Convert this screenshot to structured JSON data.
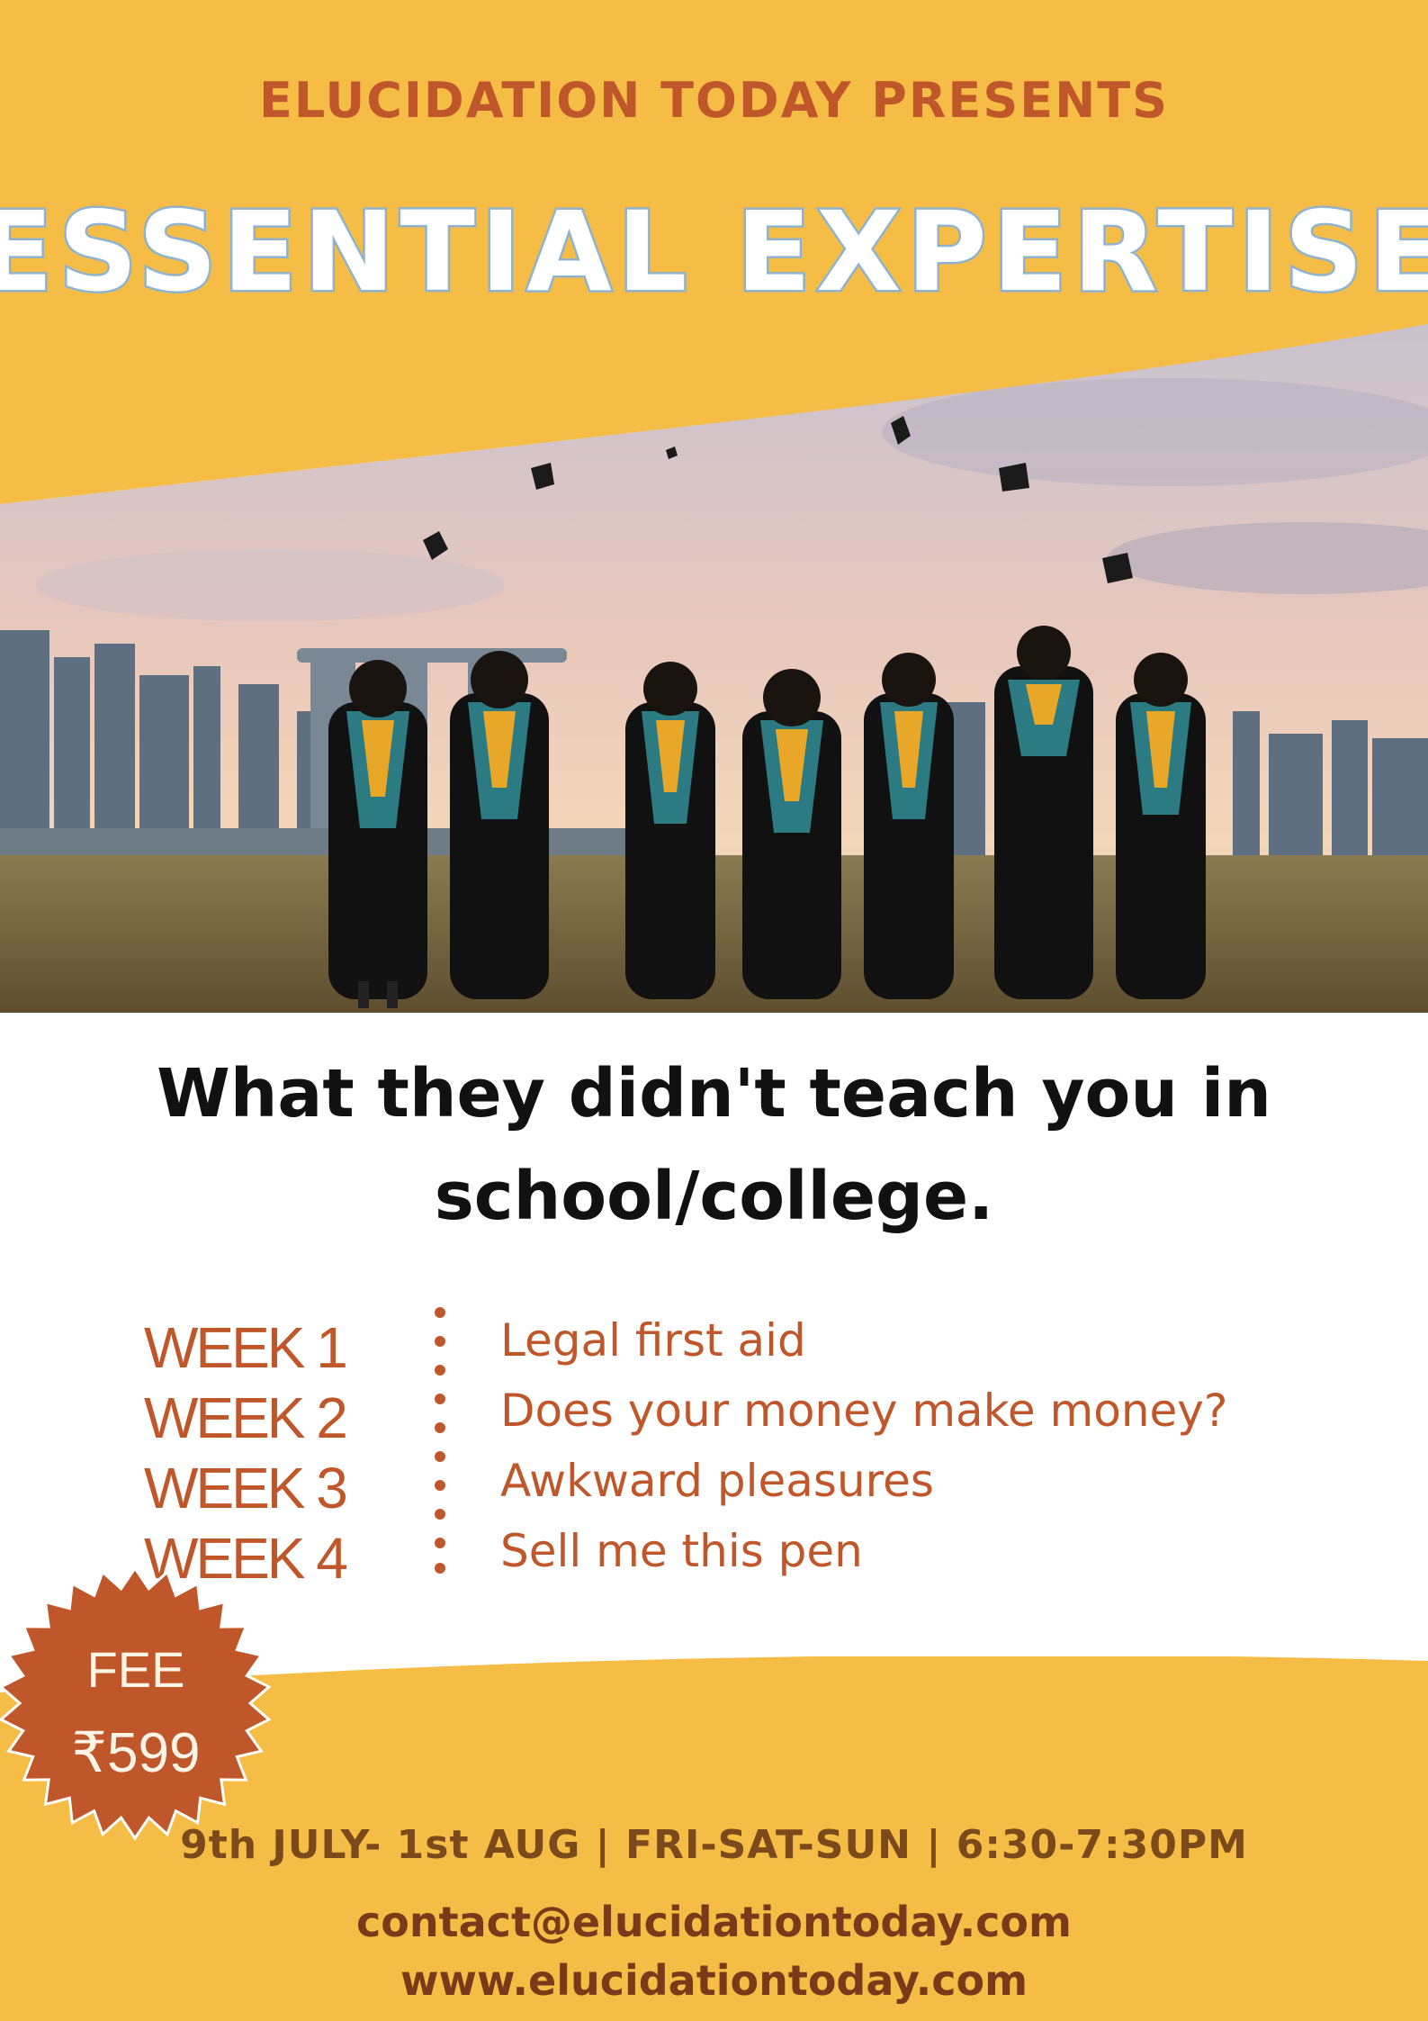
{
  "header": {
    "presents": "ELUCIDATION TODAY PRESENTS",
    "title": "ESSENTIAL EXPERTISE"
  },
  "tagline": {
    "line1": "What they didn't teach you in",
    "line2": "school/college."
  },
  "schedule_items": [
    {
      "week": "WEEK 1",
      "topic": "Legal first aid"
    },
    {
      "week": "WEEK 2",
      "topic": "Does your money make money?"
    },
    {
      "week": "WEEK 3",
      "topic": "Awkward pleasures"
    },
    {
      "week": "WEEK 4",
      "topic": "Sell me this pen"
    }
  ],
  "fee": {
    "label": "FEE",
    "amount": "₹599"
  },
  "footer": {
    "schedule": "9th JULY- 1st AUG | FRI-SAT-SUN | 6:30-7:30PM",
    "email": "contact@elucidationtoday.com",
    "website": "www.elucidationtoday.com"
  },
  "colors": {
    "background_yellow": "#f5bd45",
    "accent_orange": "#c0572a",
    "text_dark": "#111111",
    "footer_brown": "#7a3a1a"
  }
}
